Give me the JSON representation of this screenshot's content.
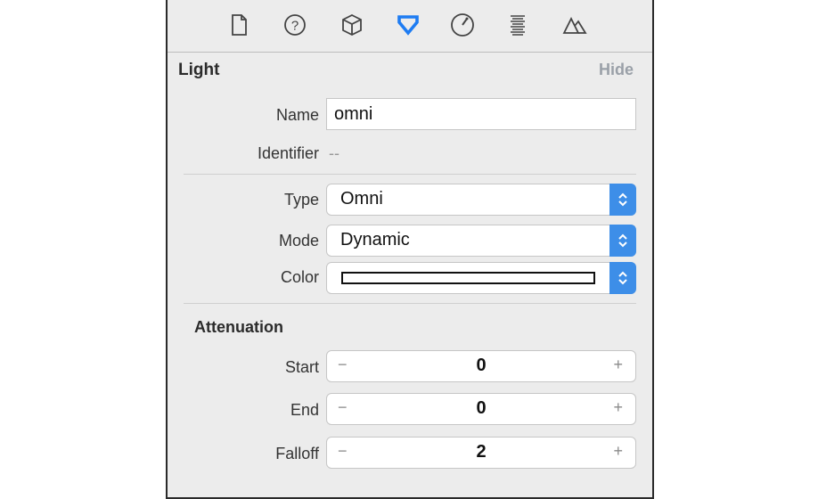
{
  "toolbar": {
    "icons": [
      "file-icon",
      "help-icon",
      "cube-icon",
      "attributes-icon",
      "physics-icon",
      "properties-icon",
      "scene-icon"
    ],
    "selected": "attributes-icon",
    "accent": "#1e7cf2"
  },
  "light": {
    "title": "Light",
    "hide_label": "Hide",
    "name_label": "Name",
    "name_value": "omni",
    "identifier_label": "Identifier",
    "identifier_value": "--",
    "type_label": "Type",
    "type_value": "Omni",
    "mode_label": "Mode",
    "mode_value": "Dynamic",
    "color_label": "Color",
    "color_value": "#ffffff"
  },
  "attenuation": {
    "title": "Attenuation",
    "start_label": "Start",
    "start_value": "0",
    "end_label": "End",
    "end_value": "0",
    "falloff_label": "Falloff",
    "falloff_value": "2",
    "minus": "−",
    "plus": "+"
  }
}
